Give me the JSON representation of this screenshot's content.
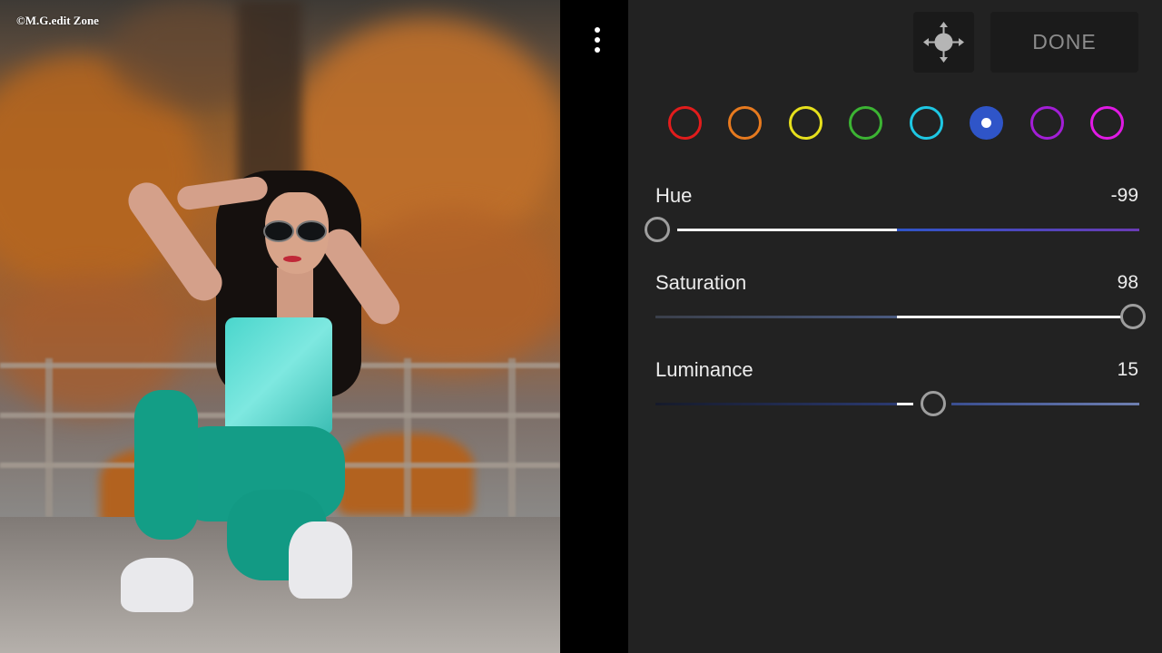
{
  "photo": {
    "watermark": "©M.G.edit Zone"
  },
  "header": {
    "done_label": "DONE",
    "move_icon": "move-arrows-icon",
    "menu_icon": "more-vertical-icon"
  },
  "color_channels": [
    {
      "name": "red",
      "color": "#e21c1c",
      "selected": false
    },
    {
      "name": "orange",
      "color": "#e77a1f",
      "selected": false
    },
    {
      "name": "yellow",
      "color": "#e6e01c",
      "selected": false
    },
    {
      "name": "green",
      "color": "#3cb433",
      "selected": false
    },
    {
      "name": "aqua",
      "color": "#1ec7e3",
      "selected": false
    },
    {
      "name": "blue",
      "color": "#2f55c8",
      "selected": true
    },
    {
      "name": "purple",
      "color": "#a31ed6",
      "selected": false
    },
    {
      "name": "magenta",
      "color": "#e01ae4",
      "selected": false
    }
  ],
  "sliders": {
    "hue": {
      "label": "Hue",
      "value": "-99"
    },
    "saturation": {
      "label": "Saturation",
      "value": "98"
    },
    "luminance": {
      "label": "Luminance",
      "value": "15"
    }
  }
}
